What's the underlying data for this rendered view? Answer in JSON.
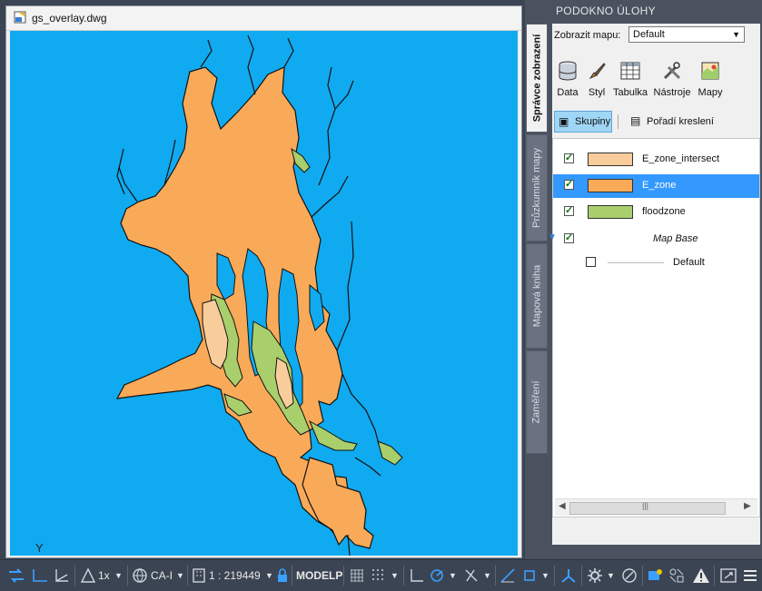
{
  "document": {
    "title": "gs_overlay.dwg",
    "ucs_label": "Y"
  },
  "task_pane": {
    "title": "PODOKNO ÚLOHY",
    "tabs": [
      {
        "label": "Správce zobrazení",
        "active": true
      },
      {
        "label": "Průzkumník mapy",
        "active": false
      },
      {
        "label": "Mapová kniha",
        "active": false
      },
      {
        "label": "Zaměření",
        "active": false
      }
    ],
    "show_map_label": "Zobrazit mapu:",
    "show_map_value": "Default",
    "tools": [
      {
        "label": "Data",
        "icon": "data-icon"
      },
      {
        "label": "Styl",
        "icon": "style-icon"
      },
      {
        "label": "Tabulka",
        "icon": "table-icon"
      },
      {
        "label": "Nástroje",
        "icon": "tools-icon"
      },
      {
        "label": "Mapy",
        "icon": "maps-icon"
      }
    ],
    "groups_label": "Skupiny",
    "draw_order_label": "Pořadí kreslení",
    "layers": [
      {
        "name": "E_zone_intersect",
        "checked": true,
        "color": "#f9cc9b",
        "selected": false
      },
      {
        "name": "E_zone",
        "checked": true,
        "color": "#f9aa59",
        "selected": true
      },
      {
        "name": "floodzone",
        "checked": true,
        "color": "#a9cf6d",
        "selected": false
      }
    ],
    "map_base": {
      "name": "Map Base",
      "checked": true
    },
    "base_default": {
      "name": "Default",
      "checked": false
    },
    "scroll_grip": "|||"
  },
  "statusbar": {
    "scale_factor": "1x",
    "coord_system": "CA-I",
    "scale": "1 : 219449",
    "space": "MODELP"
  },
  "colors": {
    "water": "#10aaf0",
    "e_zone": "#f9aa59",
    "e_zone_intersect": "#f9cc9b",
    "floodzone": "#a9cf6d",
    "selection": "#3399ff"
  }
}
